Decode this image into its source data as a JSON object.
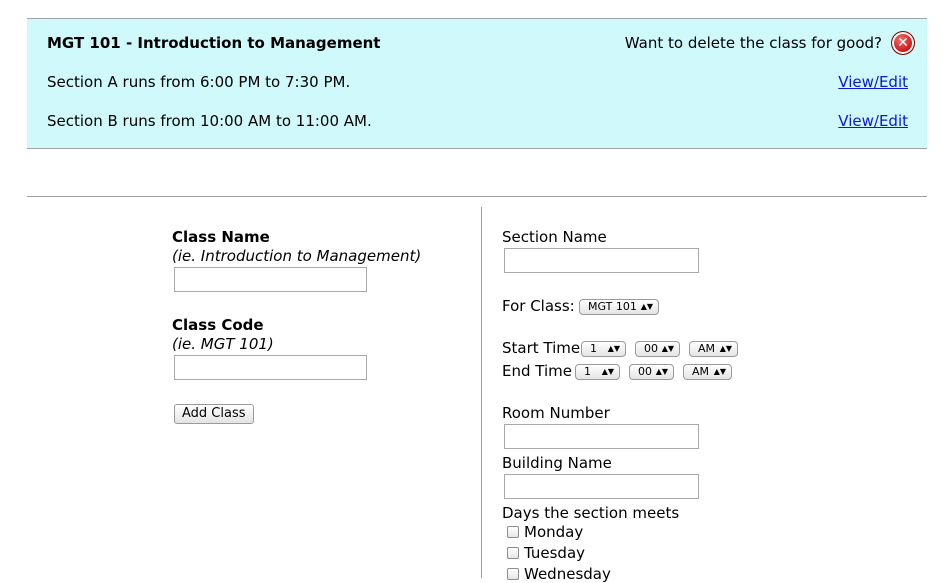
{
  "class_panel": {
    "title": "MGT 101 - Introduction to Management",
    "delete_prompt": "Want to delete the class for good?",
    "delete_icon": "close-circle-icon",
    "sections": [
      {
        "text": "Section A runs from 6:00 PM to 7:30 PM.",
        "link": "View/Edit"
      },
      {
        "text": "Section B runs from 10:00 AM to 11:00 AM.",
        "link": "View/Edit"
      }
    ]
  },
  "add_class_form": {
    "class_name_label": "Class Name",
    "class_name_hint": "(ie. Introduction to Management)",
    "class_name_value": "",
    "class_code_label": "Class Code",
    "class_code_hint": "(ie. MGT 101)",
    "class_code_value": "",
    "add_button": "Add Class"
  },
  "section_form": {
    "section_name_label": "Section Name",
    "for_class_label": "For Class:",
    "for_class_value": "MGT 101",
    "start_time_label": "Start Time",
    "end_time_label": "End Time",
    "start_time": {
      "hour": "1",
      "minute": "00",
      "ampm": "AM"
    },
    "end_time": {
      "hour": "1",
      "minute": "00",
      "ampm": "AM"
    },
    "room_number_label": "Room Number",
    "building_name_label": "Building Name",
    "days_label": "Days the section meets",
    "days": [
      "Monday",
      "Tuesday",
      "Wednesday"
    ]
  }
}
